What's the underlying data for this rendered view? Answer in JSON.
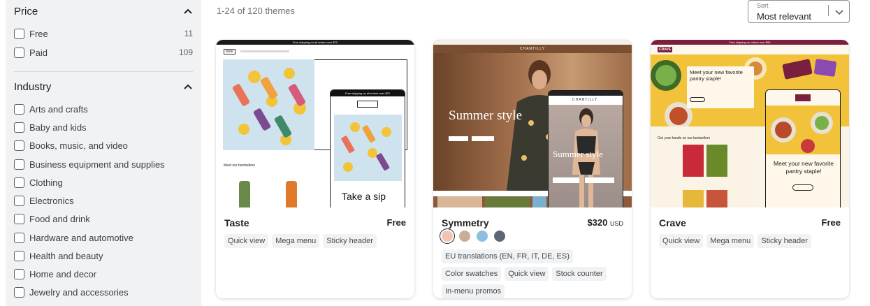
{
  "sidebar": {
    "price": {
      "title": "Price",
      "options": [
        {
          "label": "Free",
          "count": "11"
        },
        {
          "label": "Paid",
          "count": "109"
        }
      ]
    },
    "industry": {
      "title": "Industry",
      "options": [
        {
          "label": "Arts and crafts"
        },
        {
          "label": "Baby and kids"
        },
        {
          "label": "Books, music, and video"
        },
        {
          "label": "Business equipment and supplies"
        },
        {
          "label": "Clothing"
        },
        {
          "label": "Electronics"
        },
        {
          "label": "Food and drink"
        },
        {
          "label": "Hardware and automotive"
        },
        {
          "label": "Health and beauty"
        },
        {
          "label": "Home and decor"
        },
        {
          "label": "Jewelry and accessories"
        }
      ]
    }
  },
  "results_text": "1-24 of 120 themes",
  "sort": {
    "label": "Sort",
    "value": "Most relevant"
  },
  "themes": [
    {
      "name": "Taste",
      "price": "Free",
      "tags": [
        "Quick view",
        "Mega menu",
        "Sticky header"
      ],
      "preview": {
        "announcement": "Free shipping on all orders over $70",
        "logo": "taste",
        "section_title": "Meet our bestsellers",
        "mobile_announcement": "Free shipping on all orders over $70",
        "mobile_heading": "Take a sip"
      }
    },
    {
      "name": "Symmetry",
      "price": "$320",
      "currency": "USD",
      "swatches": [
        "#f2c4b5",
        "#c9ad96",
        "#8ebde0",
        "#5e6675"
      ],
      "tags": [
        "EU translations (EN, FR, IT, DE, ES)",
        "Color swatches",
        "Quick view",
        "Stock counter",
        "In-menu promos"
      ],
      "preview": {
        "logo": "CHANTILLY",
        "heading": "Summer style",
        "mobile_heading": "Summer style",
        "mobile_logo": "CHANTILLY"
      }
    },
    {
      "name": "Crave",
      "price": "Free",
      "tags": [
        "Quick view",
        "Mega menu",
        "Sticky header"
      ],
      "preview": {
        "announcement": "Free shipping on orders over $50",
        "logo": "CRAVE",
        "heading": "Meet your new favorite pantry staple!",
        "section_title": "Get your hands on our bestsellers",
        "mobile_heading": "Meet your new favorite pantry staple!"
      }
    }
  ],
  "colors": {
    "sidebar_bg": "#f1f2f3",
    "tag_bg": "#f1f2f3",
    "crave_red": "#7a1f3d",
    "symmetry_brown": "#8a5a3a"
  }
}
